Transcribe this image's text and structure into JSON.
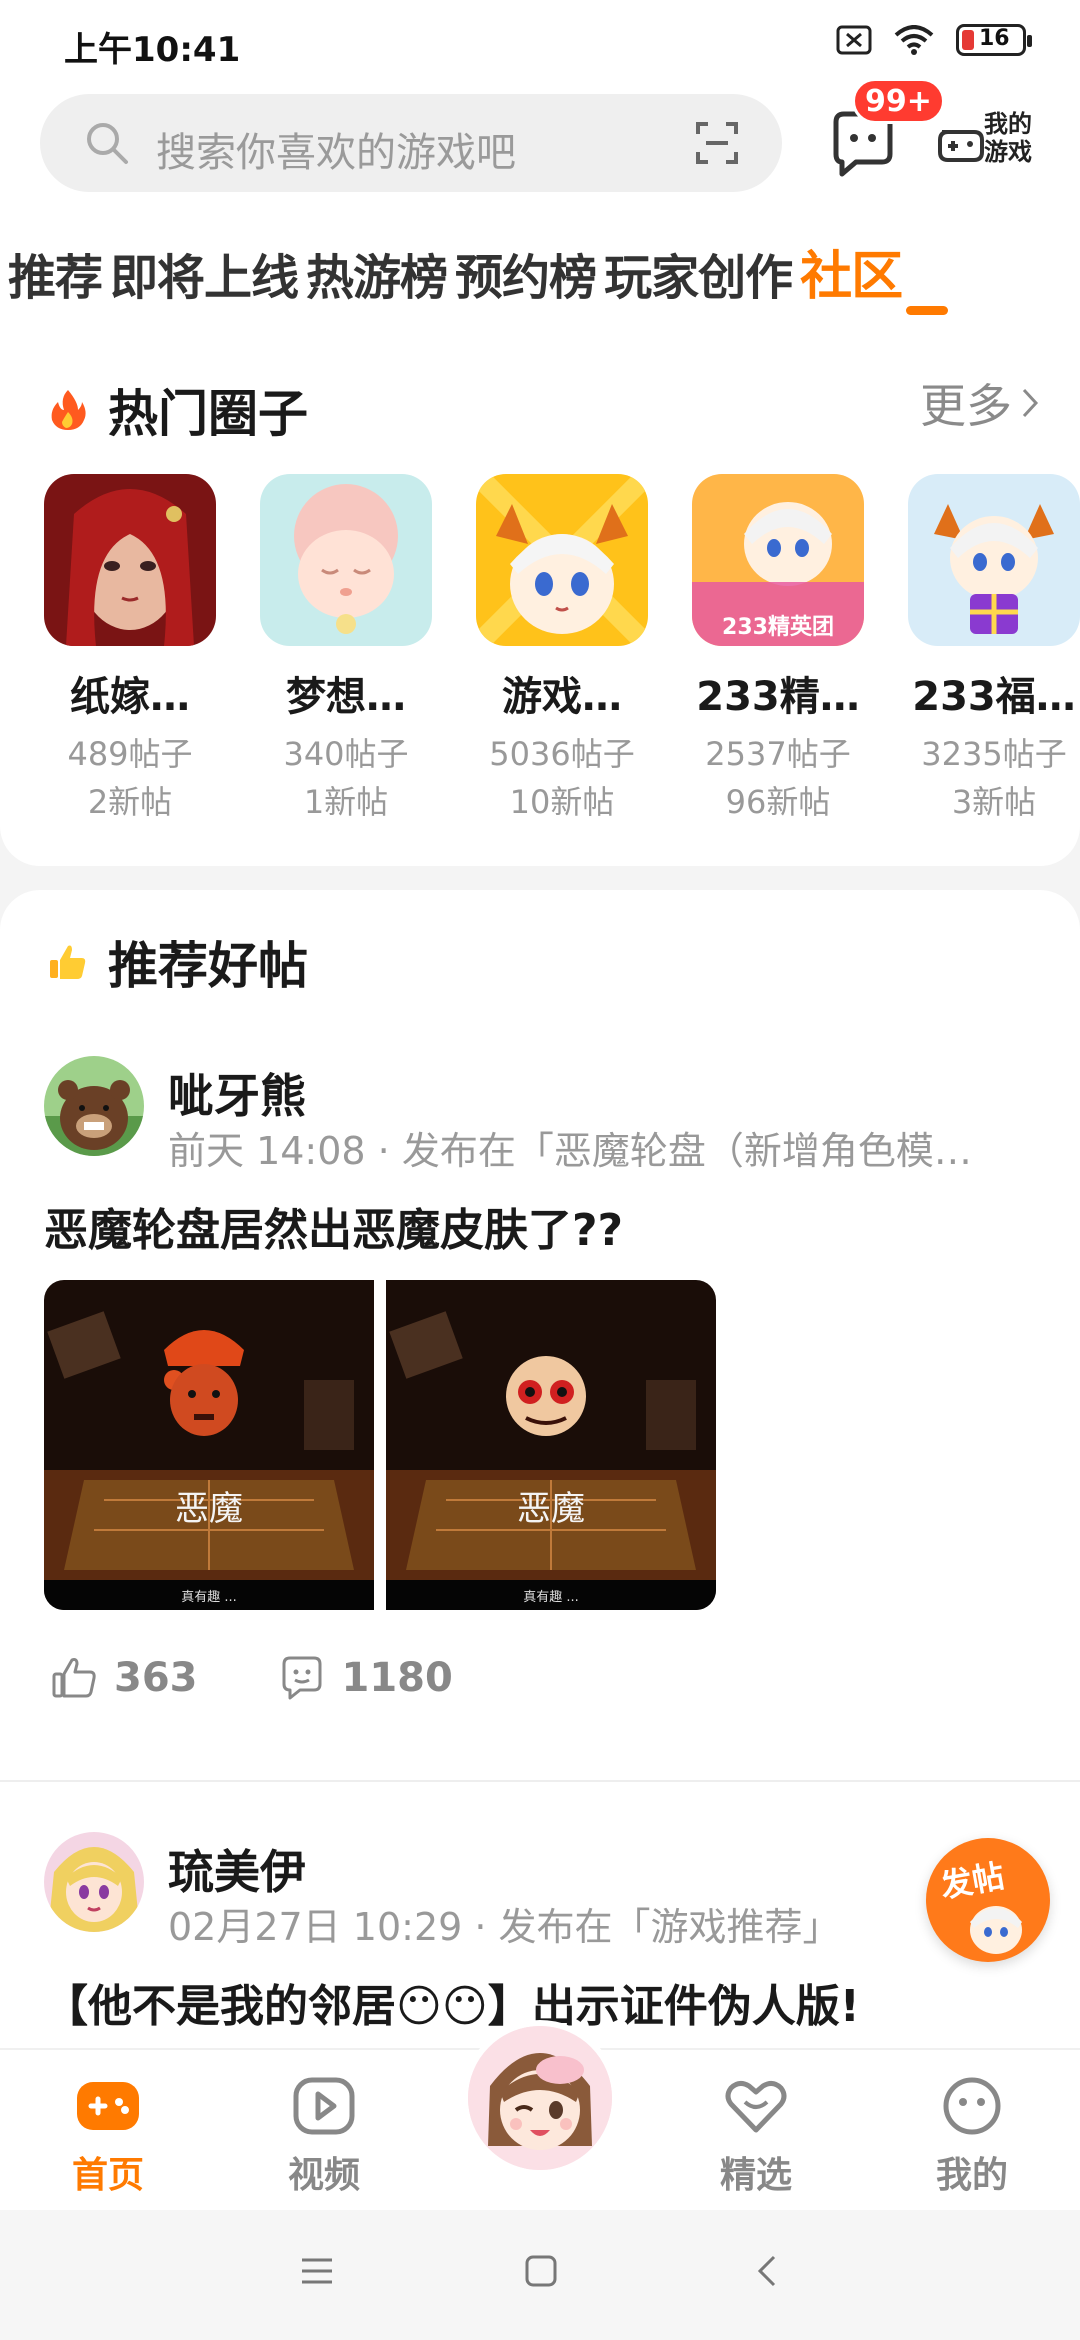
{
  "status": {
    "time": "上午10:41",
    "battery": "16"
  },
  "search": {
    "placeholder": "搜索你喜欢的游戏吧",
    "badge": "99+",
    "my_games": "我的游戏"
  },
  "tabs": [
    {
      "label": "推荐"
    },
    {
      "label": "即将上线"
    },
    {
      "label": "热游榜"
    },
    {
      "label": "预约榜"
    },
    {
      "label": "玩家创作"
    },
    {
      "label": "社区",
      "active": true
    }
  ],
  "hot_circles": {
    "title": "热门圈子",
    "more": "更多",
    "items": [
      {
        "name": "纸嫁…",
        "posts": "489帖子",
        "new": "2新帖"
      },
      {
        "name": "梦想…",
        "posts": "340帖子",
        "new": "1新帖"
      },
      {
        "name": "游戏…",
        "posts": "5036帖子",
        "new": "10新帖"
      },
      {
        "name": "233精…",
        "posts": "2537帖子",
        "new": "96新帖",
        "thumb_text": "233精英团"
      },
      {
        "name": "233福…",
        "posts": "3235帖子",
        "new": "3新帖"
      }
    ]
  },
  "recommended": {
    "title": "推荐好帖",
    "posts": [
      {
        "author": "呲牙熊",
        "meta": "前天 14:08 · 发布在「恶魔轮盘（新增角色模…",
        "title": "恶魔轮盘居然出恶魔皮肤了??",
        "image_captions": [
          "恶魔",
          "恶魔"
        ],
        "image_subs": [
          "真有趣 ...",
          "真有趣 ..."
        ],
        "likes": "363",
        "comments": "1180"
      },
      {
        "author": "琉美伊",
        "meta": "02月27日 10:29 · 发布在「游戏推荐」",
        "title": "【他不是我的邻居😶😶】出示证件伪人版!"
      }
    ]
  },
  "fab": {
    "label": "发帖"
  },
  "bottom_nav": [
    {
      "label": "首页",
      "active": true
    },
    {
      "label": "视频"
    },
    {
      "label": "精选"
    },
    {
      "label": "我的"
    }
  ],
  "colors": {
    "accent": "#ff7a00",
    "badge": "#ff3b30"
  }
}
